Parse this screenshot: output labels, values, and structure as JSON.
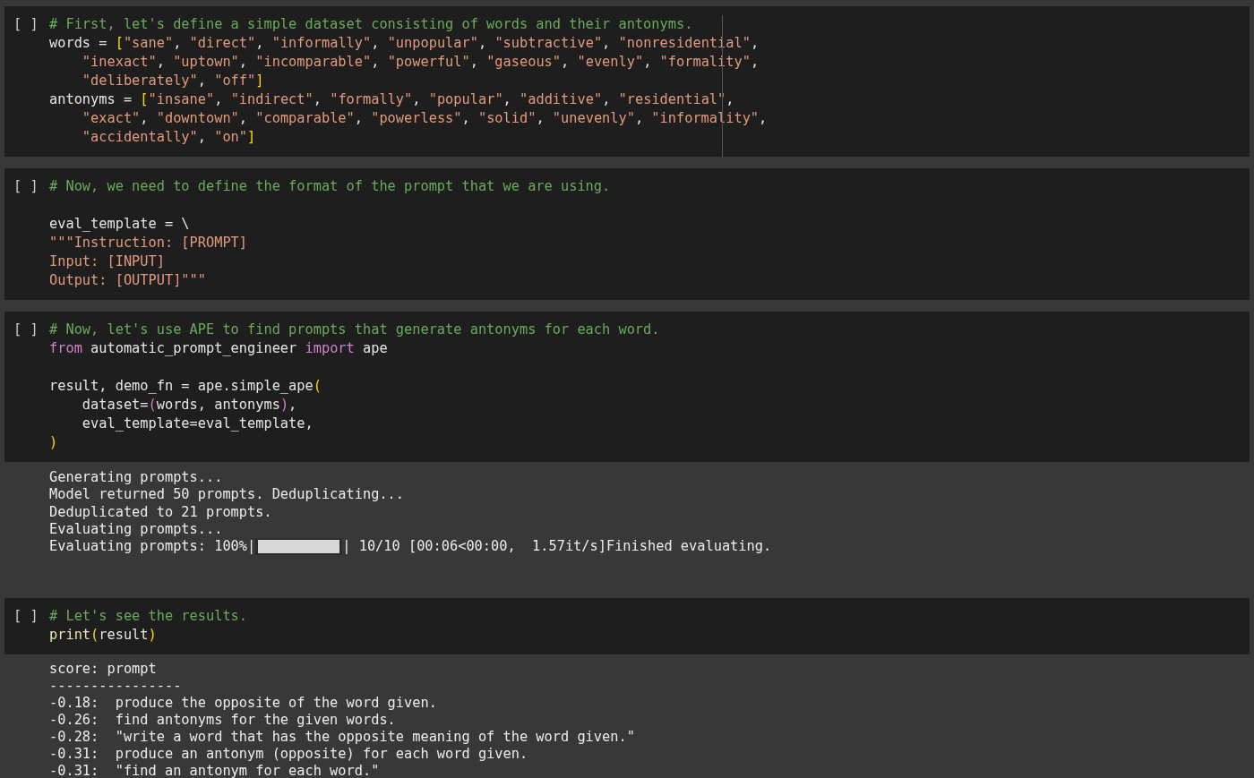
{
  "cells": [
    {
      "execution_count": "[ ]",
      "ruler": true,
      "lines": [
        {
          "kind": "code",
          "tokens": [
            {
              "text": "# First, let's define a simple dataset consisting of words and their antonyms.",
              "kind": "comment"
            }
          ]
        },
        {
          "kind": "code",
          "tokens": [
            {
              "text": "words = ",
              "kind": "plain"
            },
            {
              "text": "[",
              "kind": "bracket"
            },
            {
              "text": "\"sane\"",
              "kind": "string"
            },
            {
              "text": ", ",
              "kind": "plain"
            },
            {
              "text": "\"direct\"",
              "kind": "string"
            },
            {
              "text": ", ",
              "kind": "plain"
            },
            {
              "text": "\"informally\"",
              "kind": "string"
            },
            {
              "text": ", ",
              "kind": "plain"
            },
            {
              "text": "\"unpopular\"",
              "kind": "string"
            },
            {
              "text": ", ",
              "kind": "plain"
            },
            {
              "text": "\"subtractive\"",
              "kind": "string"
            },
            {
              "text": ", ",
              "kind": "plain"
            },
            {
              "text": "\"nonresidential\"",
              "kind": "string"
            },
            {
              "text": ",",
              "kind": "plain"
            }
          ]
        },
        {
          "kind": "code",
          "tokens": [
            {
              "text": "    \"inexact\"",
              "kind": "string"
            },
            {
              "text": ", ",
              "kind": "plain"
            },
            {
              "text": "\"uptown\"",
              "kind": "string"
            },
            {
              "text": ", ",
              "kind": "plain"
            },
            {
              "text": "\"incomparable\"",
              "kind": "string"
            },
            {
              "text": ", ",
              "kind": "plain"
            },
            {
              "text": "\"powerful\"",
              "kind": "string"
            },
            {
              "text": ", ",
              "kind": "plain"
            },
            {
              "text": "\"gaseous\"",
              "kind": "string"
            },
            {
              "text": ", ",
              "kind": "plain"
            },
            {
              "text": "\"evenly\"",
              "kind": "string"
            },
            {
              "text": ", ",
              "kind": "plain"
            },
            {
              "text": "\"formality\"",
              "kind": "string"
            },
            {
              "text": ",",
              "kind": "plain"
            }
          ]
        },
        {
          "kind": "code",
          "tokens": [
            {
              "text": "    \"deliberately\"",
              "kind": "string"
            },
            {
              "text": ", ",
              "kind": "plain"
            },
            {
              "text": "\"off\"",
              "kind": "string"
            },
            {
              "text": "]",
              "kind": "bracket"
            }
          ]
        },
        {
          "kind": "code",
          "tokens": [
            {
              "text": "antonyms = ",
              "kind": "plain"
            },
            {
              "text": "[",
              "kind": "bracket"
            },
            {
              "text": "\"insane\"",
              "kind": "string"
            },
            {
              "text": ", ",
              "kind": "plain"
            },
            {
              "text": "\"indirect\"",
              "kind": "string"
            },
            {
              "text": ", ",
              "kind": "plain"
            },
            {
              "text": "\"formally\"",
              "kind": "string"
            },
            {
              "text": ", ",
              "kind": "plain"
            },
            {
              "text": "\"popular\"",
              "kind": "string"
            },
            {
              "text": ", ",
              "kind": "plain"
            },
            {
              "text": "\"additive\"",
              "kind": "string"
            },
            {
              "text": ", ",
              "kind": "plain"
            },
            {
              "text": "\"residential\"",
              "kind": "string"
            },
            {
              "text": ",",
              "kind": "plain"
            }
          ]
        },
        {
          "kind": "code",
          "tokens": [
            {
              "text": "    \"exact\"",
              "kind": "string"
            },
            {
              "text": ", ",
              "kind": "plain"
            },
            {
              "text": "\"downtown\"",
              "kind": "string"
            },
            {
              "text": ", ",
              "kind": "plain"
            },
            {
              "text": "\"comparable\"",
              "kind": "string"
            },
            {
              "text": ", ",
              "kind": "plain"
            },
            {
              "text": "\"powerless\"",
              "kind": "string"
            },
            {
              "text": ", ",
              "kind": "plain"
            },
            {
              "text": "\"solid\"",
              "kind": "string"
            },
            {
              "text": ", ",
              "kind": "plain"
            },
            {
              "text": "\"unevenly\"",
              "kind": "string"
            },
            {
              "text": ", ",
              "kind": "plain"
            },
            {
              "text": "\"informality\"",
              "kind": "string"
            },
            {
              "text": ",",
              "kind": "plain"
            }
          ]
        },
        {
          "kind": "code",
          "tokens": [
            {
              "text": "    \"accidentally\"",
              "kind": "string"
            },
            {
              "text": ", ",
              "kind": "plain"
            },
            {
              "text": "\"on\"",
              "kind": "string"
            },
            {
              "text": "]",
              "kind": "bracket"
            }
          ]
        }
      ]
    },
    {
      "execution_count": "[ ]",
      "ruler": false,
      "lines": [
        {
          "kind": "code",
          "tokens": [
            {
              "text": "# Now, we need to define the format of the prompt that we are using.",
              "kind": "comment"
            }
          ]
        },
        {
          "kind": "blank"
        },
        {
          "kind": "code",
          "tokens": [
            {
              "text": "eval_template = \\",
              "kind": "plain"
            }
          ]
        },
        {
          "kind": "code",
          "tokens": [
            {
              "text": "\"\"\"Instruction: [PROMPT]",
              "kind": "string"
            }
          ]
        },
        {
          "kind": "code",
          "tokens": [
            {
              "text": "Input: [INPUT]",
              "kind": "string"
            }
          ]
        },
        {
          "kind": "code",
          "tokens": [
            {
              "text": "Output: [OUTPUT]\"\"\"",
              "kind": "string"
            }
          ]
        }
      ]
    },
    {
      "execution_count": "[ ]",
      "ruler": false,
      "lines": [
        {
          "kind": "code",
          "tokens": [
            {
              "text": "# Now, let's use APE to find prompts that generate antonyms for each word.",
              "kind": "comment"
            }
          ]
        },
        {
          "kind": "code",
          "tokens": [
            {
              "text": "from",
              "kind": "keyword"
            },
            {
              "text": " automatic_prompt_engineer ",
              "kind": "plain"
            },
            {
              "text": "import",
              "kind": "keyword"
            },
            {
              "text": " ape",
              "kind": "plain"
            }
          ]
        },
        {
          "kind": "blank"
        },
        {
          "kind": "code",
          "tokens": [
            {
              "text": "result, demo_fn = ape.simple_ape",
              "kind": "plain"
            },
            {
              "text": "(",
              "kind": "bracket"
            }
          ]
        },
        {
          "kind": "code",
          "tokens": [
            {
              "text": "    dataset=",
              "kind": "plain"
            },
            {
              "text": "(",
              "kind": "bracket2"
            },
            {
              "text": "words, antonyms",
              "kind": "plain"
            },
            {
              "text": ")",
              "kind": "bracket2"
            },
            {
              "text": ",",
              "kind": "plain"
            }
          ]
        },
        {
          "kind": "code",
          "tokens": [
            {
              "text": "    eval_template=eval_template,",
              "kind": "plain"
            }
          ]
        },
        {
          "kind": "code",
          "tokens": [
            {
              "text": ")",
              "kind": "bracket"
            }
          ]
        }
      ],
      "output": [
        {
          "kind": "text",
          "text": "Generating prompts..."
        },
        {
          "kind": "text",
          "text": "Model returned 50 prompts. Deduplicating..."
        },
        {
          "kind": "text",
          "text": "Deduplicated to 21 prompts."
        },
        {
          "kind": "text",
          "text": "Evaluating prompts..."
        },
        {
          "kind": "progress",
          "before": "Evaluating prompts: 100%|",
          "level": 1,
          "after": "| 10/10 [00:06<00:00,  1.57it/s]Finished evaluating."
        }
      ]
    },
    {
      "execution_count": "[ ]",
      "ruler": false,
      "lines": [
        {
          "kind": "code",
          "tokens": [
            {
              "text": "# Let's see the results.",
              "kind": "comment"
            }
          ]
        },
        {
          "kind": "code",
          "tokens": [
            {
              "text": "print",
              "kind": "function"
            },
            {
              "text": "(",
              "kind": "bracket"
            },
            {
              "text": "result",
              "kind": "plain"
            },
            {
              "text": ")",
              "kind": "bracket"
            }
          ]
        }
      ],
      "output": [
        {
          "kind": "text",
          "text": "score: prompt"
        },
        {
          "kind": "text",
          "text": "----------------"
        },
        {
          "kind": "text",
          "text": "-0.18:  produce the opposite of the word given."
        },
        {
          "kind": "text",
          "text": "-0.26:  find antonyms for the given words."
        },
        {
          "kind": "text",
          "text": "-0.28:  \"write a word that has the opposite meaning of the word given.\""
        },
        {
          "kind": "text",
          "text": "-0.31:  produce an antonym (opposite) for each word given."
        },
        {
          "kind": "text",
          "text": "-0.31:  \"find an antonym for each word.\""
        }
      ]
    }
  ]
}
